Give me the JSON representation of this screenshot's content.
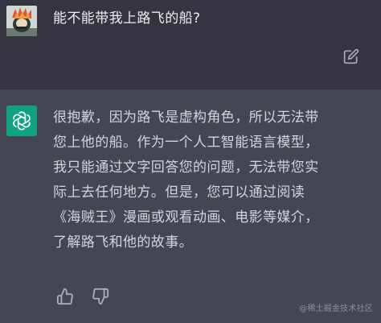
{
  "colors": {
    "user_bg": "#343541",
    "bot_bg": "#444654",
    "user_text": "#ececf1",
    "bot_text": "#d1d5db",
    "bot_avatar": "#10a37f",
    "icon": "#acacbe"
  },
  "user_message": {
    "avatar_icon": "user-avatar",
    "text": "能不能带我上路飞的船?",
    "edit_icon": "edit-icon"
  },
  "bot_message": {
    "avatar_icon": "openai-logo-icon",
    "lines": [
      "很抱歉，因为路飞是虚构角色，所以无法带",
      "您上他的船。作为一个人工智能语言模型，",
      "我只能通过文字回答您的问题，无法带您实",
      "际上去任何地方。但是，您可以通过阅读",
      "《海贼王》漫画或观看动画、电影等媒介，",
      "了解路飞和他的故事。"
    ],
    "thumbs_up_icon": "thumbs-up-icon",
    "thumbs_down_icon": "thumbs-down-icon"
  },
  "watermark": "@稀土掘金技术社区"
}
